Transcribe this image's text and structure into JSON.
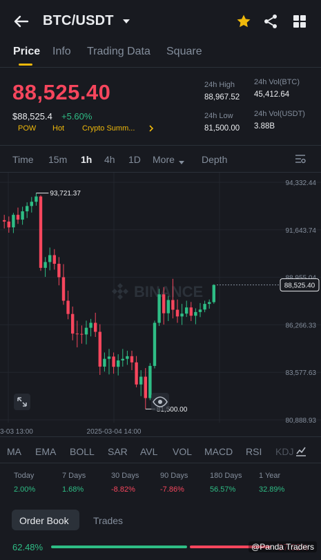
{
  "header": {
    "pair": "BTC/USDT"
  },
  "tabs": [
    {
      "label": "Price"
    },
    {
      "label": "Info"
    },
    {
      "label": "Trading Data"
    },
    {
      "label": "Square"
    }
  ],
  "price": {
    "last": "88,525.40",
    "usd": "$88,525.4",
    "change": "+5.60%",
    "tags": [
      "POW",
      "Hot",
      "Crypto Summ..."
    ],
    "stats": {
      "high_label": "24h High",
      "high_value": "88,967.52",
      "volbtc_label": "24h Vol(BTC)",
      "volbtc_value": "45,412.64",
      "low_label": "24h Low",
      "low_value": "81,500.00",
      "volusdt_label": "24h Vol(USDT)",
      "volusdt_value": "3.88B"
    }
  },
  "intervals": {
    "items": [
      "Time",
      "15m",
      "1h",
      "4h",
      "1D",
      "More"
    ],
    "active": "1h",
    "depth": "Depth"
  },
  "chart_data": {
    "type": "candlestick",
    "y_ticks": [
      "94,332.44",
      "91,643.74",
      "88,955.04",
      "86,266.33",
      "83,577.63",
      "80,888.93"
    ],
    "y_range": [
      80888.93,
      94332.44
    ],
    "x_ticks": [
      "3-03 13:00",
      "2025-03-04 14:00"
    ],
    "high_marker": "93,721.37",
    "low_marker": "81,500.00",
    "current_price": "88,525.40",
    "watermark": "BINANCE",
    "candles": [
      [
        92190,
        92490,
        91720,
        92110
      ],
      [
        92110,
        92400,
        91480,
        91780
      ],
      [
        91780,
        92600,
        91460,
        92490
      ],
      [
        92490,
        92900,
        91980,
        92220
      ],
      [
        92220,
        92950,
        91930,
        92690
      ],
      [
        92690,
        93200,
        92310,
        92990
      ],
      [
        92990,
        93500,
        92620,
        93230
      ],
      [
        93230,
        93721.37,
        93010,
        93530
      ],
      [
        93530,
        93600,
        89320,
        89490
      ],
      [
        89490,
        90100,
        88980,
        89820
      ],
      [
        89820,
        90640,
        89350,
        90210
      ],
      [
        90210,
        90550,
        89390,
        89720
      ],
      [
        89720,
        90100,
        88500,
        88960
      ],
      [
        88960,
        89700,
        87400,
        87630
      ],
      [
        87630,
        88200,
        86580,
        86880
      ],
      [
        86880,
        87300,
        85390,
        85770
      ],
      [
        85770,
        86500,
        84990,
        85750
      ],
      [
        85750,
        86230,
        85200,
        85720
      ],
      [
        85720,
        86500,
        85160,
        86100
      ],
      [
        86100,
        86600,
        85610,
        86380
      ],
      [
        86380,
        86950,
        85580,
        85870
      ],
      [
        85870,
        86300,
        83430,
        83900
      ],
      [
        83900,
        84700,
        83620,
        84340
      ],
      [
        84340,
        84900,
        83460,
        84470
      ],
      [
        84470,
        84700,
        83500,
        83890
      ],
      [
        83890,
        84600,
        83400,
        84250
      ],
      [
        84250,
        84900,
        83900,
        84340
      ],
      [
        84340,
        84800,
        84000,
        84490
      ],
      [
        84490,
        84800,
        83700,
        84140
      ],
      [
        84140,
        84500,
        82730,
        82890
      ],
      [
        82890,
        83700,
        82230,
        83330
      ],
      [
        83330,
        83820,
        81500,
        82120
      ],
      [
        82120,
        84100,
        82000,
        83940
      ],
      [
        83940,
        86500,
        83800,
        86380
      ],
      [
        86380,
        88300,
        86200,
        87990
      ],
      [
        87990,
        88400,
        86280,
        86920
      ],
      [
        86920,
        87900,
        86480,
        87670
      ],
      [
        87670,
        88870,
        86630,
        87120
      ],
      [
        87120,
        87700,
        86380,
        86740
      ],
      [
        86740,
        87450,
        86260,
        86900
      ],
      [
        86900,
        87630,
        86710,
        87250
      ],
      [
        87250,
        87560,
        86480,
        86780
      ],
      [
        86780,
        87200,
        86300,
        86990
      ],
      [
        86990,
        87500,
        86700,
        87130
      ],
      [
        87130,
        87630,
        86980,
        87450
      ],
      [
        87450,
        87700,
        87180,
        87550
      ],
      [
        87550,
        88560,
        87460,
        88525.4
      ]
    ]
  },
  "indicators": [
    "MA",
    "EMA",
    "BOLL",
    "SAR",
    "AVL",
    "VOL",
    "MACD",
    "RSI",
    "KDJ"
  ],
  "performance": [
    {
      "label": "Today",
      "value": "2.00%",
      "dir": "up"
    },
    {
      "label": "7 Days",
      "value": "1.68%",
      "dir": "up"
    },
    {
      "label": "30 Days",
      "value": "-8.82%",
      "dir": "down"
    },
    {
      "label": "90 Days",
      "value": "-7.86%",
      "dir": "down"
    },
    {
      "label": "180 Days",
      "value": "56.57%",
      "dir": "up"
    },
    {
      "label": "1 Year",
      "value": "32.89%",
      "dir": "up"
    }
  ],
  "order_tabs": [
    {
      "label": "Order Book"
    },
    {
      "label": "Trades"
    }
  ],
  "book_ratio": {
    "buy_pct": "62.48%",
    "buy_fraction": 0.6248,
    "sell_pct": "37.52%"
  },
  "watermark_badge": "@Panda Traders",
  "colors": {
    "up": "#2ebd85",
    "down": "#f6465d",
    "accent": "#f0b90b",
    "bg": "#181a20"
  }
}
